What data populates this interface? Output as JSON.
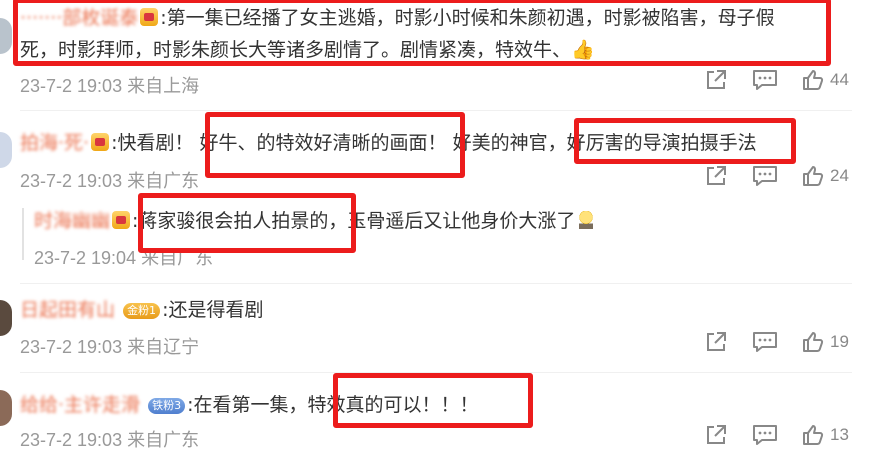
{
  "comments": [
    {
      "username": "·······部枚诞泰",
      "text_line1": ":第一集已经播了女主逃婚，时影小时候和朱颜初遇，时影被陷害，母子假",
      "text_line2": "死，时影拜师，时影朱颜长大等诸多剧情了。剧情紧凑，特效牛、👍",
      "time": "23-7-2 19:03",
      "location": "来自上海",
      "likes": "44"
    },
    {
      "username": "拍海·死·",
      "text_a": ":快看剧！",
      "text_b": "好牛、的特效好清晰的画面！",
      "text_c": "好美的神官，",
      "text_d": "好厉害的导演拍摄手法",
      "time": "23-7-2 19:03",
      "location": "来自广东",
      "likes": "24"
    },
    {
      "username": "时海幽幽",
      "text_a": ":蒋家骏很会拍人拍景的",
      "text_b": "，玉骨遥后又让他身价大涨了",
      "time": "23-7-2 19:04",
      "location": "来自广东"
    },
    {
      "username": "日起田有山",
      "badge": "金粉1",
      "text": ":还是得看剧",
      "time": "23-7-2 19:03",
      "location": "来自辽宁",
      "likes": "19"
    },
    {
      "username": "给给·主许走滑",
      "badge": "铁粉3",
      "text_a": ":在看第一集，",
      "text_b": "特效真的可以！！！",
      "time": "23-7-2 19:03",
      "location": "来自广东",
      "likes": "13"
    }
  ],
  "colors": {
    "highlight_box": "#ec1c1c",
    "meta_text": "#999999"
  }
}
